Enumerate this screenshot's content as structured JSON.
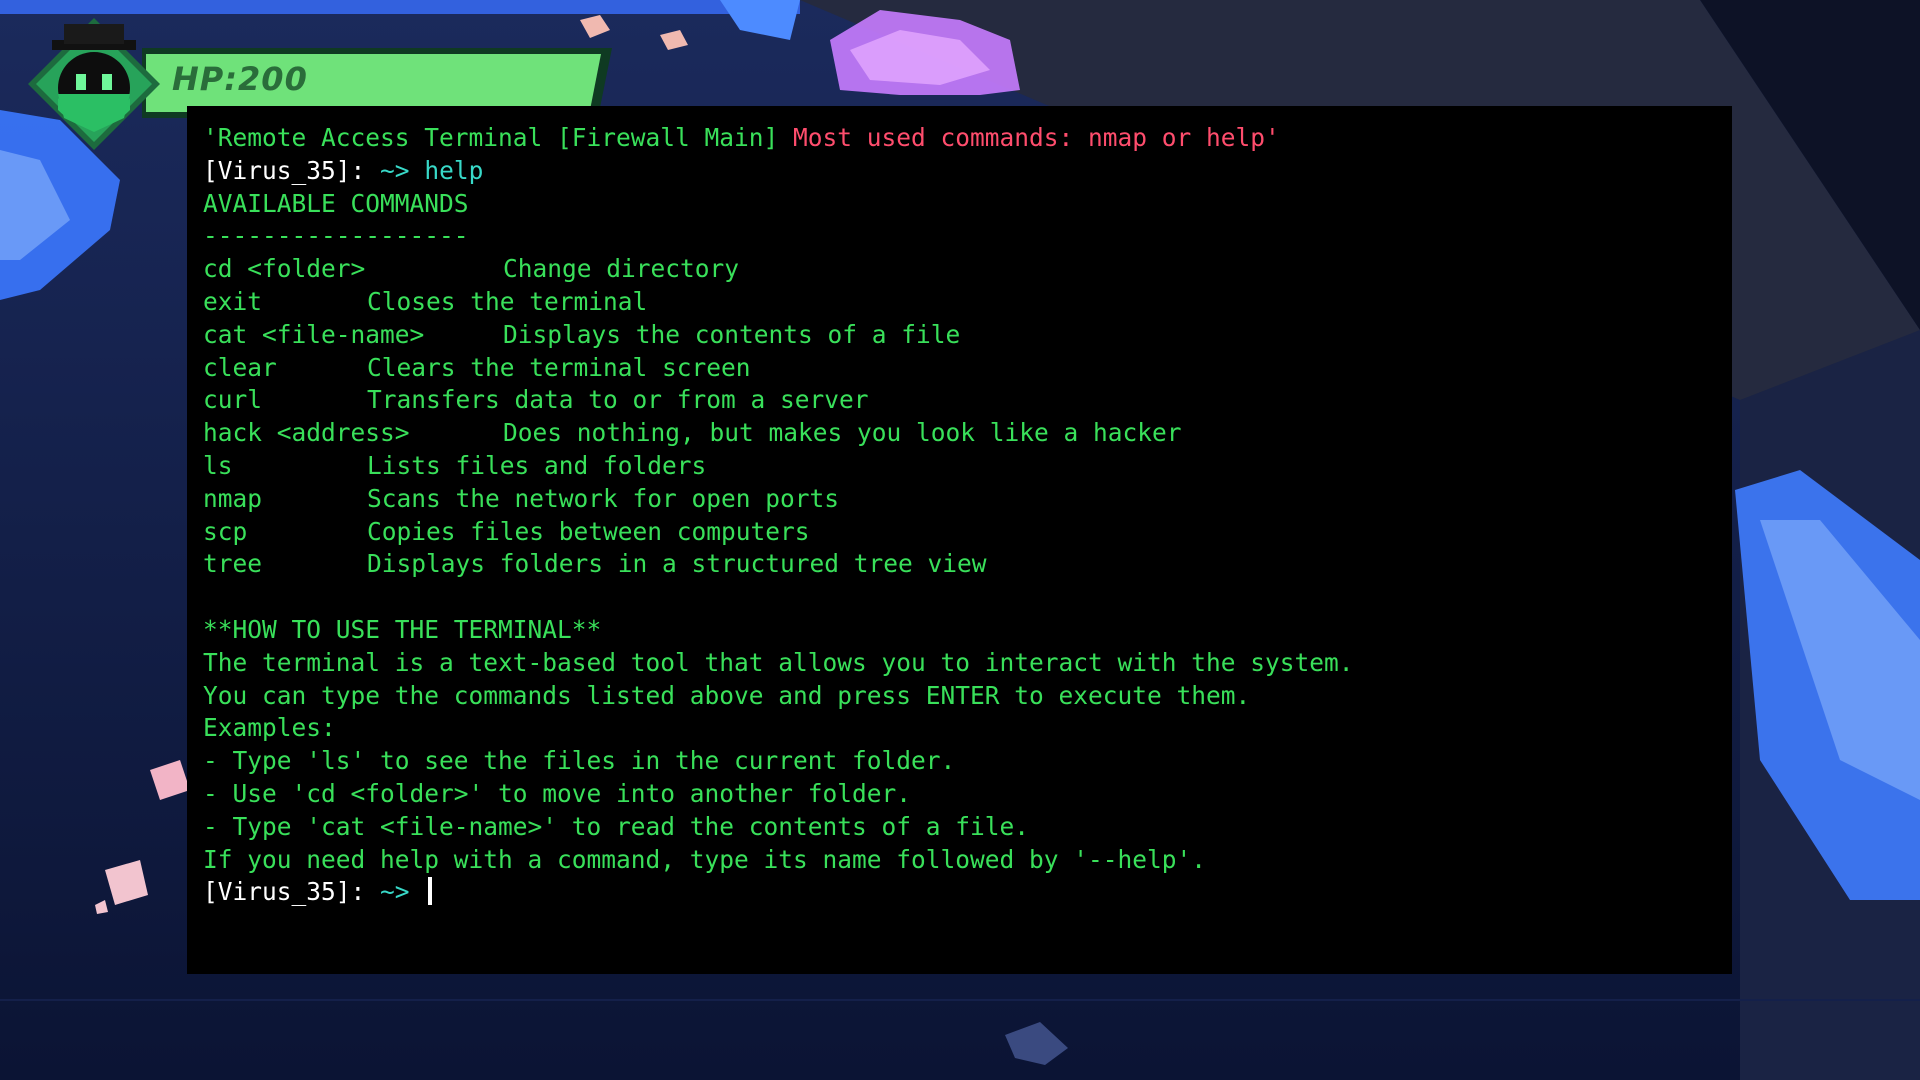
{
  "hud": {
    "hp_text": "HP:200",
    "hp_fill_fraction": 1.0,
    "avatar_icon": "hacker-avatar-icon"
  },
  "terminal": {
    "header": {
      "title": "'Remote Access Terminal [Firewall Main]",
      "hint": "Most used commands: nmap or help'"
    },
    "prompt_user": "[Virus_35]",
    "prompt_sep": ":",
    "prompt_path": "~>",
    "entered_command": "help",
    "section_title": "AVAILABLE COMMANDS",
    "separator": "------------------",
    "commands": [
      {
        "name": "cd <folder>",
        "desc": "Change directory",
        "wide": true
      },
      {
        "name": "exit",
        "desc": "Closes the terminal",
        "wide": false
      },
      {
        "name": "cat <file-name>",
        "desc": "Displays the contents of a file",
        "wide": true
      },
      {
        "name": "clear",
        "desc": "Clears the terminal screen",
        "wide": false
      },
      {
        "name": "curl",
        "desc": "Transfers data to or from a server",
        "wide": false
      },
      {
        "name": "hack <address>",
        "desc": "Does nothing, but makes you look like a hacker",
        "wide": true
      },
      {
        "name": "ls",
        "desc": "Lists files and folders",
        "wide": false
      },
      {
        "name": "nmap",
        "desc": "Scans the network for open ports",
        "wide": false
      },
      {
        "name": "scp",
        "desc": "Copies files between computers",
        "wide": false
      },
      {
        "name": "tree",
        "desc": "Displays folders in a structured tree view",
        "wide": false
      }
    ],
    "howto_title": "**HOW TO USE THE TERMINAL**",
    "howto_lines": [
      "The terminal is a text-based tool that allows you to interact with the system.",
      "You can type the commands listed above and press ENTER to execute them.",
      "Examples:",
      "- Type 'ls' to see the files in the current folder.",
      "- Use 'cd <folder>' to move into another folder.",
      "- Type 'cat <file-name>' to read the contents of a file.",
      "If you need help with a command, type its name followed by '--help'."
    ],
    "input_value": ""
  },
  "colors": {
    "terminal_bg": "#000000",
    "text_green": "#39e05a",
    "prompt_white": "#ffffff",
    "path_cyan": "#38d9c8",
    "hint_red": "#ff4d6d",
    "hp_green": "#6fe27a"
  }
}
